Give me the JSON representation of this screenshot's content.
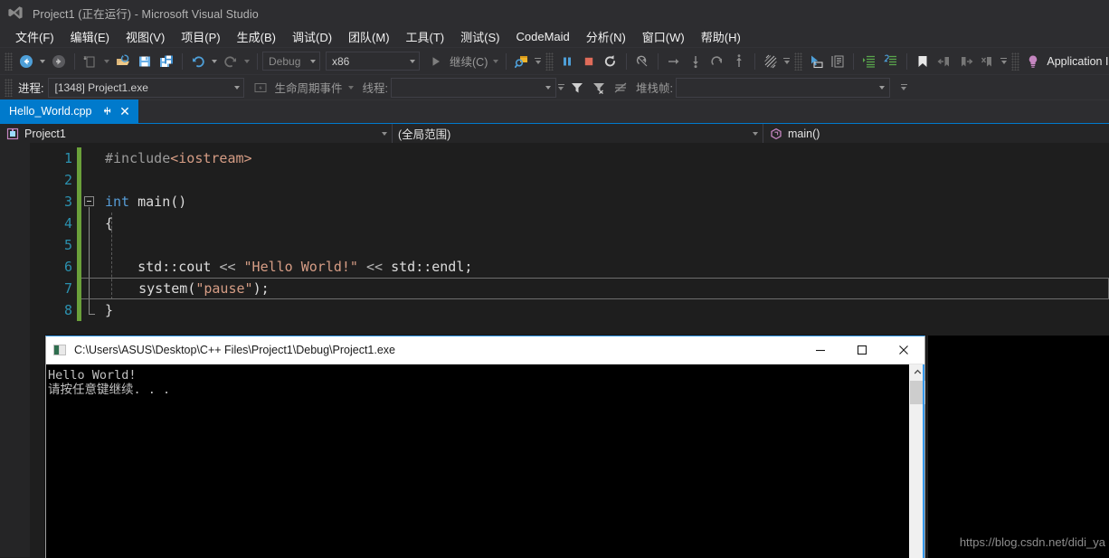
{
  "window": {
    "title": "Project1 (正在运行) - Microsoft Visual Studio",
    "logo_icon": "visual-studio-logo-icon"
  },
  "menubar": {
    "items": [
      {
        "label": "文件(F)"
      },
      {
        "label": "编辑(E)"
      },
      {
        "label": "视图(V)"
      },
      {
        "label": "项目(P)"
      },
      {
        "label": "生成(B)"
      },
      {
        "label": "调试(D)"
      },
      {
        "label": "团队(M)"
      },
      {
        "label": "工具(T)"
      },
      {
        "label": "测试(S)"
      },
      {
        "label": "CodeMaid"
      },
      {
        "label": "分析(N)"
      },
      {
        "label": "窗口(W)"
      },
      {
        "label": "帮助(H)"
      }
    ]
  },
  "toolbar": {
    "navigate_back_icon": "navigate-back-icon",
    "navigate_forward_icon": "navigate-forward-icon",
    "new_item_icon": "new-item-icon",
    "open_file_icon": "open-file-icon",
    "save_icon": "save-icon",
    "save_all_icon": "save-all-icon",
    "undo_icon": "undo-icon",
    "redo_icon": "redo-icon",
    "config_value": "Debug",
    "platform_value": "x86",
    "continue_label": "继续(C)",
    "start_debug_icon": "start-debug-icon",
    "attach_process_icon": "attach-to-process-icon",
    "break_all_icon": "pause-icon",
    "stop_debug_icon": "stop-icon",
    "restart_icon": "restart-icon",
    "show_next_statement_icon": "show-next-statement-icon",
    "step_over_icon": "step-over-icon",
    "step_into_icon": "step-into-icon",
    "step_out_icon": "step-out-icon",
    "step_return_icon": "step-return-icon",
    "hot_reload_icon": "hot-reload-icon",
    "select_tool_icon": "pointer-select-icon",
    "comment_icon": "comment-selection-icon",
    "indent_icon": "increase-indent-icon",
    "outdent_icon": "decrease-indent-icon",
    "bookmark_icon": "bookmark-icon",
    "prev_bookmark_icon": "previous-bookmark-icon",
    "next_bookmark_icon": "next-bookmark-icon",
    "clear_bookmarks_icon": "clear-bookmarks-icon",
    "insights_label": "Application Insights",
    "insights_icon": "lightbulb-icon",
    "overflow_icon": "toolbar-overflow-icon"
  },
  "debug_toolbar": {
    "process_label": "进程:",
    "process_value": "[1348] Project1.exe",
    "lifecycle_icon": "lifecycle-events-icon",
    "lifecycle_label": "生命周期事件",
    "thread_label": "线程:",
    "thread_value": "",
    "filter_icon": "filter-icon",
    "filter_clear_icon": "clear-filter-icon",
    "no_filter_icon": "disable-filter-icon",
    "stackframe_label": "堆栈帧:",
    "stackframe_value": ""
  },
  "tabs": {
    "active": {
      "label": "Hello_World.cpp",
      "pin_icon": "pin-icon",
      "close_icon": "close-icon"
    }
  },
  "navbar": {
    "project_icon": "project-icon",
    "project_value": "Project1",
    "scope_value": "(全局范围)",
    "member_icon": "method-icon",
    "member_value": "main()"
  },
  "editor": {
    "line_numbers": [
      "1",
      "2",
      "3",
      "4",
      "5",
      "6",
      "7",
      "8"
    ],
    "lines": [
      {
        "n": 1,
        "tokens": [
          {
            "t": "#include",
            "c": "tok-pre"
          },
          {
            "t": "<iostream>",
            "c": "tok-inc"
          }
        ]
      },
      {
        "n": 2,
        "tokens": []
      },
      {
        "n": 3,
        "tokens": [
          {
            "t": "int",
            "c": "tok-kw"
          },
          {
            "t": " ",
            "c": "tok-punc"
          },
          {
            "t": "main",
            "c": "tok-fn"
          },
          {
            "t": "()",
            "c": "tok-punc"
          }
        ]
      },
      {
        "n": 4,
        "tokens": [
          {
            "t": "{",
            "c": "tok-punc"
          }
        ]
      },
      {
        "n": 5,
        "tokens": []
      },
      {
        "n": 6,
        "tokens": [
          {
            "t": "    std",
            "c": "tok-id"
          },
          {
            "t": "::",
            "c": "tok-punc"
          },
          {
            "t": "cout ",
            "c": "tok-id"
          },
          {
            "t": "<< ",
            "c": "tok-op"
          },
          {
            "t": "\"Hello World!\"",
            "c": "tok-str"
          },
          {
            "t": " << ",
            "c": "tok-op"
          },
          {
            "t": "std",
            "c": "tok-id"
          },
          {
            "t": "::",
            "c": "tok-punc"
          },
          {
            "t": "endl",
            "c": "tok-id"
          },
          {
            "t": ";",
            "c": "tok-punc"
          }
        ]
      },
      {
        "n": 7,
        "tokens": [
          {
            "t": "    system",
            "c": "tok-id"
          },
          {
            "t": "(",
            "c": "tok-punc"
          },
          {
            "t": "\"pause\"",
            "c": "tok-str"
          },
          {
            "t": ")",
            "c": "tok-punc"
          },
          {
            "t": ";",
            "c": "tok-punc"
          }
        ]
      },
      {
        "n": 8,
        "tokens": [
          {
            "t": "}",
            "c": "tok-punc"
          }
        ]
      }
    ],
    "current_line": 7,
    "fold_marker_line": 3
  },
  "console": {
    "title_icon": "cmd-window-icon",
    "path": "C:\\Users\\ASUS\\Desktop\\C++ Files\\Project1\\Debug\\Project1.exe",
    "minimize_icon": "minimize-icon",
    "maximize_icon": "maximize-icon",
    "close_icon": "close-icon",
    "output_lines": [
      "Hello World!",
      "请按任意键继续. . ."
    ],
    "scroll_up_icon": "scroll-up-arrow-icon"
  },
  "watermark": {
    "text": "https://blog.csdn.net/didi_ya"
  },
  "colors": {
    "chrome": "#2d2d30",
    "editor_bg": "#1e1e1e",
    "accent": "#007acc",
    "linenum": "#2b91af",
    "string": "#d69d85",
    "keyword": "#569cd6",
    "changebar": "#6ba03a"
  }
}
